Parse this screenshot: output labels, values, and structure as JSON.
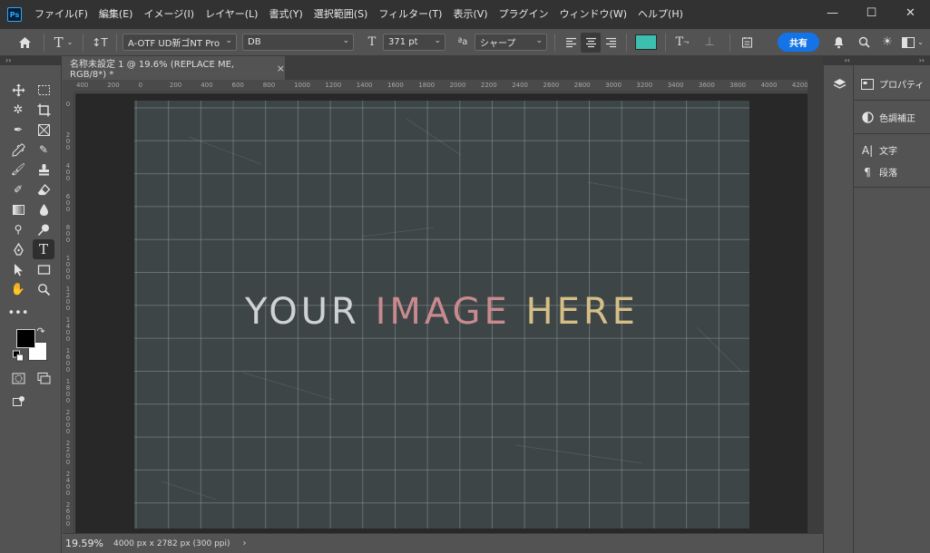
{
  "app": {
    "logo_text": "Ps"
  },
  "menu": [
    "ファイル(F)",
    "編集(E)",
    "イメージ(I)",
    "レイヤー(L)",
    "書式(Y)",
    "選択範囲(S)",
    "フィルター(T)",
    "表示(V)",
    "プラグイン",
    "ウィンドウ(W)",
    "ヘルプ(H)"
  ],
  "options": {
    "font_family": "A-OTF UD新ゴNT Pro",
    "font_style": "DB",
    "font_size": "371 pt",
    "antialias": "シャープ",
    "text_color": "#3cbfae",
    "share_label": "共有",
    "size_glyph": "T",
    "aa_glyph": "ªa"
  },
  "document": {
    "tab_title": "名称未設定 1 @ 19.6% (REPLACE ME, RGB/8*) *",
    "close_glyph": "×"
  },
  "ruler": {
    "h_ticks": [
      "400",
      "200",
      "0",
      "200",
      "400",
      "600",
      "800",
      "1000",
      "1200",
      "1400",
      "1600",
      "1800",
      "2000",
      "2200",
      "2400",
      "2600",
      "2800",
      "3000",
      "3200",
      "3400",
      "3600",
      "3800",
      "4000",
      "4200"
    ],
    "v_ticks": [
      "0",
      "2 0 0",
      "4 0 0",
      "6 0 0",
      "8 0 0",
      "1 0 0 0",
      "1 2 0 0",
      "1 4 0 0",
      "1 6 0 0",
      "1 8 0 0",
      "2 0 0 0",
      "2 2 0 0",
      "2 4 0 0",
      "2 6 0 0"
    ]
  },
  "artwork": {
    "word1": "YOUR",
    "word2": "IMAGE",
    "word3": "HERE",
    "grid_cols": 19,
    "grid_rows": 13
  },
  "status": {
    "zoom": "19.59%",
    "doc_size": "4000 px x 2782 px (300 ppi)",
    "arrow": "›"
  },
  "right_panel": {
    "properties": "プロパティ",
    "adjustments": "色調補正",
    "character": "文字",
    "paragraph": "段落"
  },
  "collapse_glyph": "‹‹",
  "expand_glyph": "››"
}
